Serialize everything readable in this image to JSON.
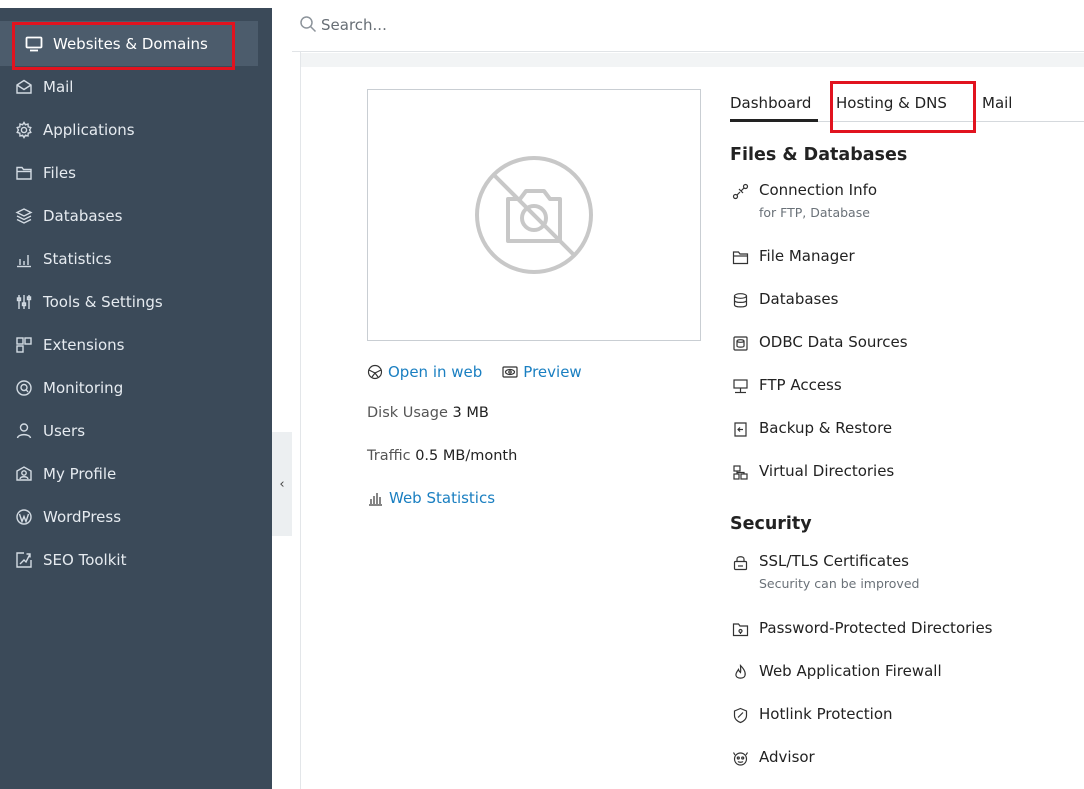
{
  "sidebar": {
    "items": [
      {
        "label": "Websites & Domains",
        "icon": "monitor-icon"
      },
      {
        "label": "Mail",
        "icon": "envelope-icon"
      },
      {
        "label": "Applications",
        "icon": "gear-icon"
      },
      {
        "label": "Files",
        "icon": "folder-icon"
      },
      {
        "label": "Databases",
        "icon": "database-icon"
      },
      {
        "label": "Statistics",
        "icon": "bar-chart-icon"
      },
      {
        "label": "Tools & Settings",
        "icon": "sliders-icon"
      },
      {
        "label": "Extensions",
        "icon": "blocks-icon"
      },
      {
        "label": "Monitoring",
        "icon": "monitoring-icon"
      },
      {
        "label": "Users",
        "icon": "user-icon"
      },
      {
        "label": "My Profile",
        "icon": "profile-icon"
      },
      {
        "label": "WordPress",
        "icon": "wordpress-icon"
      },
      {
        "label": "SEO Toolkit",
        "icon": "seo-icon"
      }
    ],
    "collapse_glyph": "‹"
  },
  "search": {
    "placeholder": "Search..."
  },
  "site": {
    "open_in_web": "Open in web",
    "preview": "Preview",
    "disk_usage_label": "Disk Usage",
    "disk_usage_value": "3 MB",
    "traffic_label": "Traffic",
    "traffic_value": "0.5 MB/month",
    "web_statistics": "Web Statistics"
  },
  "tabs": [
    {
      "label": "Dashboard",
      "active": true
    },
    {
      "label": "Hosting & DNS",
      "active": false
    },
    {
      "label": "Mail",
      "active": false
    }
  ],
  "files_databases": {
    "title": "Files & Databases",
    "items": [
      {
        "label": "Connection Info",
        "sub": "for FTP, Database",
        "icon": "connection-icon"
      },
      {
        "label": "File Manager",
        "icon": "folder-icon"
      },
      {
        "label": "Databases",
        "icon": "database-icon"
      },
      {
        "label": "ODBC Data Sources",
        "icon": "odbc-icon"
      },
      {
        "label": "FTP Access",
        "icon": "ftp-icon"
      },
      {
        "label": "Backup & Restore",
        "icon": "backup-icon"
      },
      {
        "label": "Virtual Directories",
        "icon": "directories-icon"
      }
    ]
  },
  "security": {
    "title": "Security",
    "items": [
      {
        "label": "SSL/TLS Certificates",
        "sub": "Security can be improved",
        "icon": "lock-icon"
      },
      {
        "label": "Password-Protected Directories",
        "icon": "protected-folder-icon"
      },
      {
        "label": "Web Application Firewall",
        "icon": "flame-icon"
      },
      {
        "label": "Hotlink Protection",
        "icon": "shield-icon"
      },
      {
        "label": "Advisor",
        "icon": "advisor-icon"
      }
    ]
  },
  "colors": {
    "sidebar": "#3b4a59",
    "link": "#1a7fc1",
    "highlight": "#e1131f"
  }
}
